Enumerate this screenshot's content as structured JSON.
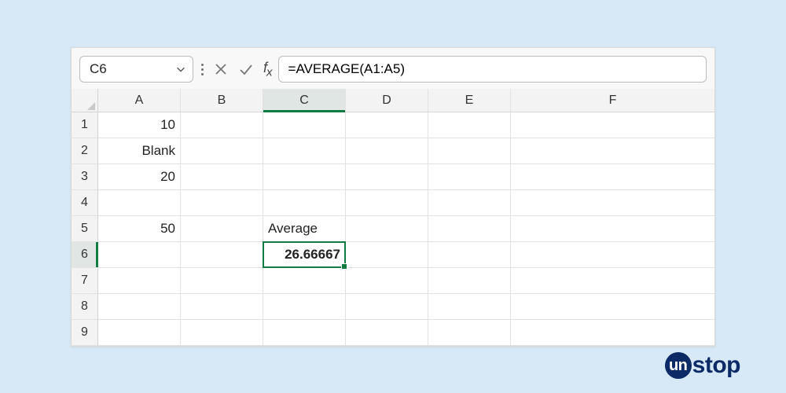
{
  "nameBox": {
    "value": "C6"
  },
  "formulaBar": {
    "value": "=AVERAGE(A1:A5)"
  },
  "columns": [
    "A",
    "B",
    "C",
    "D",
    "E",
    "F"
  ],
  "rows": [
    "1",
    "2",
    "3",
    "4",
    "5",
    "6",
    "7",
    "8",
    "9"
  ],
  "selection": {
    "col": "C",
    "row": "6"
  },
  "cells": {
    "A1": "10",
    "A2": "Blank",
    "A3": "20",
    "A5": "50",
    "C5": "Average",
    "C6": "26.66667"
  },
  "logo": {
    "prefix": "un",
    "rest": "stop"
  }
}
